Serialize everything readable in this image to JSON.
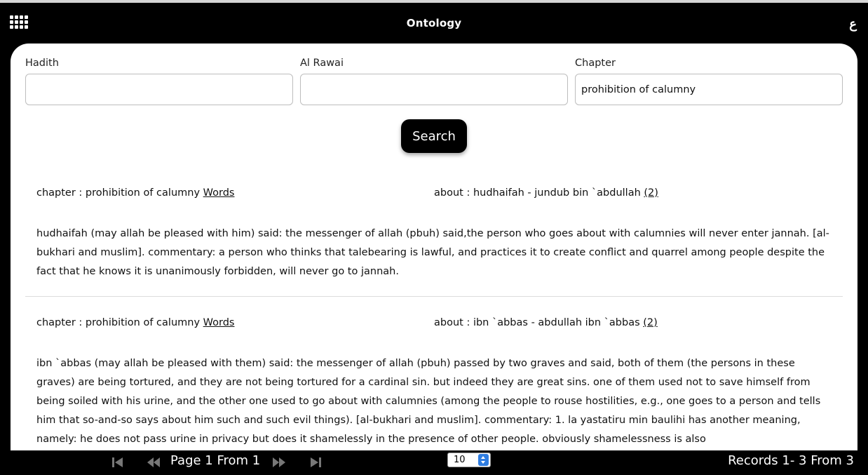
{
  "header": {
    "title": "Ontology",
    "lang_toggle": "ع",
    "menu_icon": "grid-menu-icon"
  },
  "search": {
    "hadith_label": "Hadith",
    "hadith_value": "",
    "rawai_label": "Al Rawai",
    "rawai_value": "",
    "chapter_label": "Chapter",
    "chapter_value": "prohibition of calumny",
    "button_label": "Search"
  },
  "results": [
    {
      "chapter_prefix": "chapter : prohibition of calumny",
      "words_link": "Words",
      "about_prefix": "about : hudhaifah - jundub bin `abdullah",
      "count_link": "(2)",
      "text": "hudhaifah (may allah be pleased with him) said: the messenger of allah (pbuh) said,the person who goes about with calumnies will never enter jannah. [al-bukhari and muslim]. commentary: a person who thinks that talebearing is lawful, and practices it to create conflict and quarrel among people despite the fact that he knows it is unanimously forbidden, will never go to jannah."
    },
    {
      "chapter_prefix": "chapter : prohibition of calumny",
      "words_link": "Words",
      "about_prefix": "about : ibn `abbas - abdullah ibn `abbas",
      "count_link": "(2)",
      "text": "ibn `abbas (may allah be pleased with them) said: the messenger of allah (pbuh) passed by two graves and said, both of them (the persons in these graves) are being tortured, and they are not being tortured for a cardinal sin. but indeed they are great sins. one of them used not to save himself from being soiled with his urine, and the other one used to go about with calumnies (among the people to rouse hostilities, e.g., one goes to a person and tells him that so-and-so says about him such and such evil things). [al-bukhari and muslim]. commentary: 1. la yastatiru min baulihi has another meaning, namely: he does not pass urine in privacy but does it shamelessly in the presence of other people. obviously shamelessness is also"
    }
  ],
  "footer": {
    "page_label": "Page 1 From 1",
    "per_page": "10",
    "records_label": "Records 1- 3 From 3"
  }
}
